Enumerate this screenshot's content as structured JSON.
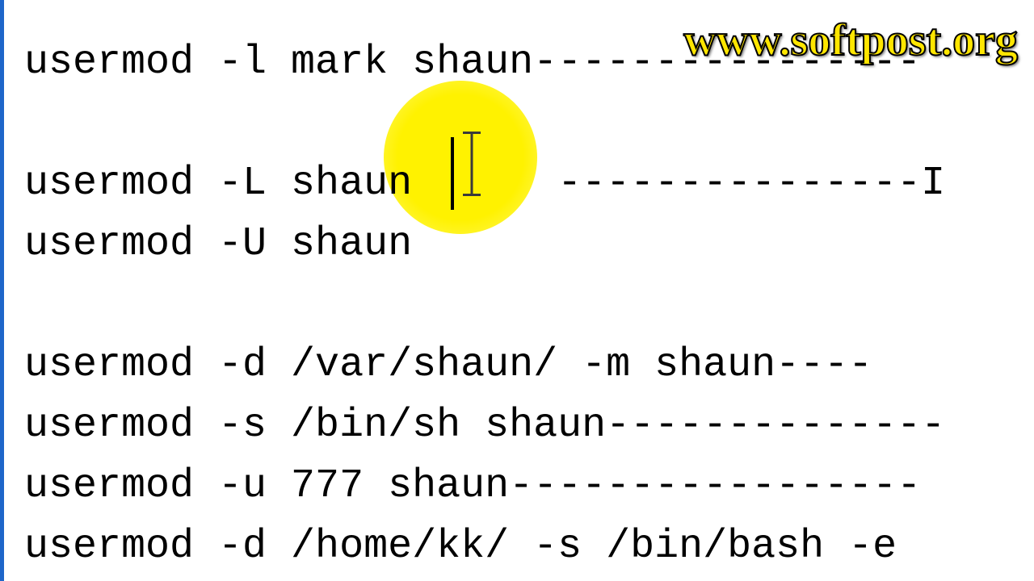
{
  "watermark": "www.softpost.org",
  "lines": {
    "l1_cmd": "usermod -l mark shaun ",
    "l1_dash": "----------------",
    "l2_cmd": "usermod -L shaun",
    "l2_dash": "---------------I",
    "l3_cmd": "usermod -U shaun",
    "l4_cmd": "usermod -d /var/shaun/ -m shaun ",
    "l4_dash": "----",
    "l5_cmd": "usermod -s /bin/sh shaun ",
    "l5_dash": "--------------",
    "l6_cmd": "usermod -u 777 shaun ",
    "l6_dash": "-----------------",
    "l7_cmd": "usermod -d /home/kk/ -s /bin/bash -e"
  }
}
